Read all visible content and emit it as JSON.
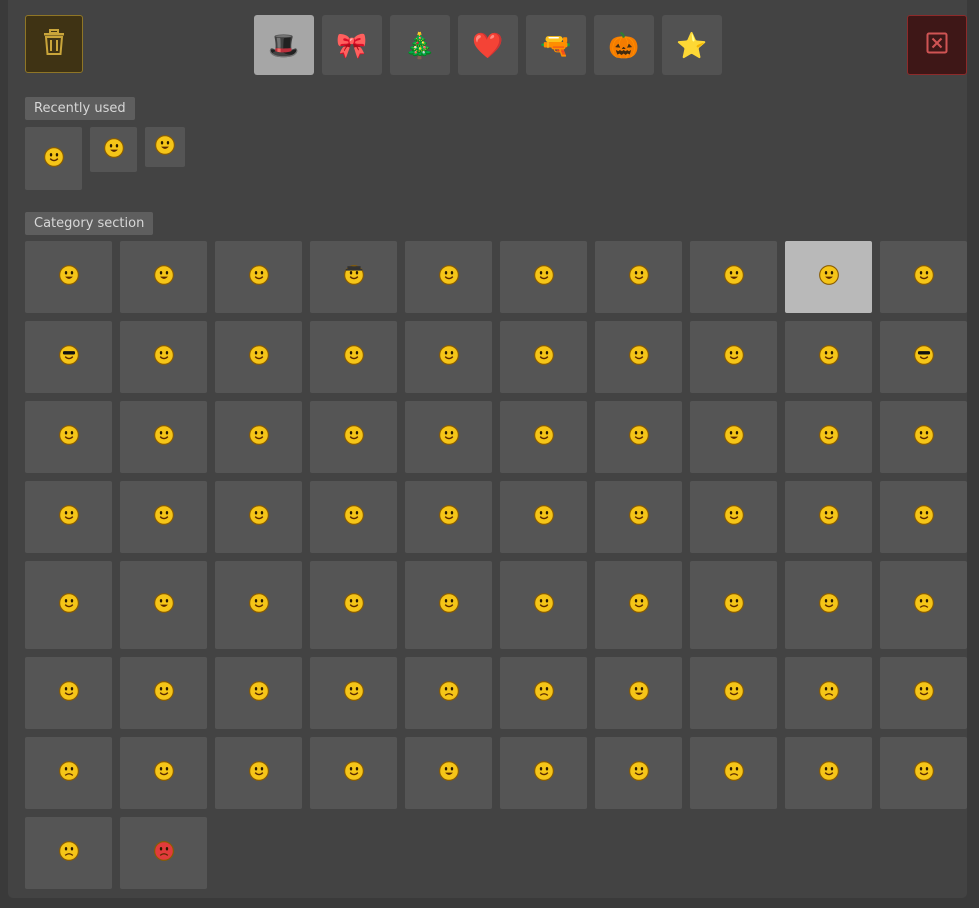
{
  "toolbar": {
    "delete_icon": "trash-icon",
    "close_icon": "close-x-icon",
    "category_tabs": [
      {
        "icon": "top-hat-icon",
        "glyph": "🎩",
        "active": true
      },
      {
        "icon": "ribbon-bow-icon",
        "glyph": "🎀",
        "active": false
      },
      {
        "icon": "christmas-tree-icon",
        "glyph": "🎄",
        "active": false
      },
      {
        "icon": "heart-icon",
        "glyph": "❤️",
        "active": false
      },
      {
        "icon": "water-gun-icon",
        "glyph": "🔫",
        "active": false
      },
      {
        "icon": "pumpkin-icon",
        "glyph": "🎃",
        "active": false
      },
      {
        "icon": "star-badge-icon",
        "glyph": "⭐",
        "active": false
      }
    ]
  },
  "recent": {
    "label": "Recently used",
    "items": [
      "confused-smiley-icon",
      "grinning-teeth-smiley-icon",
      "grin-squint-smiley-icon"
    ]
  },
  "category": {
    "label": "Category section",
    "selected_index": 8,
    "items": [
      "grin-squint-smiley-icon",
      "grinning-teeth-smiley-icon",
      "confused-smiley-icon",
      "detective-hat-smiley-icon",
      "tongue-wink-smiley-icon",
      "smile-smiley-icon",
      "happy-smiley-icon",
      "big-grin-smiley-icon",
      "laughing-smiley-icon",
      "blush-smiley-icon",
      "sunglasses-smiley-icon",
      "thinking-smiley-icon",
      "pointing-smiley-icon",
      "rolling-eyes-smiley-icon",
      "crazy-smiley-icon",
      "surprised-smiley-icon",
      "nervous-smiley-icon",
      "wink-smiley-icon",
      "headphones-smiley-icon",
      "ninja-smiley-icon",
      "warning-smiley-icon",
      "bored-smiley-icon",
      "neutral-smiley-icon",
      "crawling-smiley-icon",
      "waving-smiley-icon",
      "peace-sign-smiley-icon",
      "sleepy-smiley-icon",
      "scream-smiley-icon",
      "finger-pointing-smiley-icon",
      "hands-up-smiley-icon",
      "hugging-smiley-icon",
      "bandana-smiley-icon",
      "computer-smiley-icon",
      "melting-computer-smiley-icon",
      "sitting-smiley-icon",
      "gold-trophy-smiley-icon",
      "silver-trophy-smiley-icon",
      "bronze-trophy-smiley-icon",
      "race-car-smiley-icon",
      "friends-smiley-icon",
      "gift-smiley-icon",
      "yawn-smiley-icon",
      "cheers-smiley-icon",
      "congratulations-balloon-smiley-icon",
      "cake-smiley-icon",
      "gardening-smiley-icon",
      "mowing-smiley-icon",
      "red-cap-smiley-icon",
      "bowtie-smiley-icon",
      "worried-smiley-icon",
      "smirk-smiley-icon",
      "sigh-smiley-icon",
      "kiss-smiley-icon",
      "shy-smiley-icon",
      "frown-smiley-icon",
      "disgusted-smiley-icon",
      "shouting-smiley-icon",
      "facepalm-smiley-icon",
      "sad-smiley-icon",
      "dizzy-smiley-icon",
      "frustrated-smiley-icon",
      "tongue-out-smiley-icon",
      "sarcastic-smiley-icon",
      "hmm-smiley-icon",
      "shocked-smiley-icon",
      "melted-smiley-icon",
      "scared-smiley-icon",
      "pouting-smiley-icon",
      "army-helmet-smiley-icon",
      "ruler-smiley-icon",
      "grumpy-smiley-icon",
      "angry-red-smiley-icon"
    ]
  },
  "colors": {
    "smiley_yellow": "#f5c518",
    "smiley_outline": "#8a5c00",
    "angry_red": "#e23b3b",
    "delete_accent": "#c9a53a",
    "close_accent": "#d05454"
  }
}
